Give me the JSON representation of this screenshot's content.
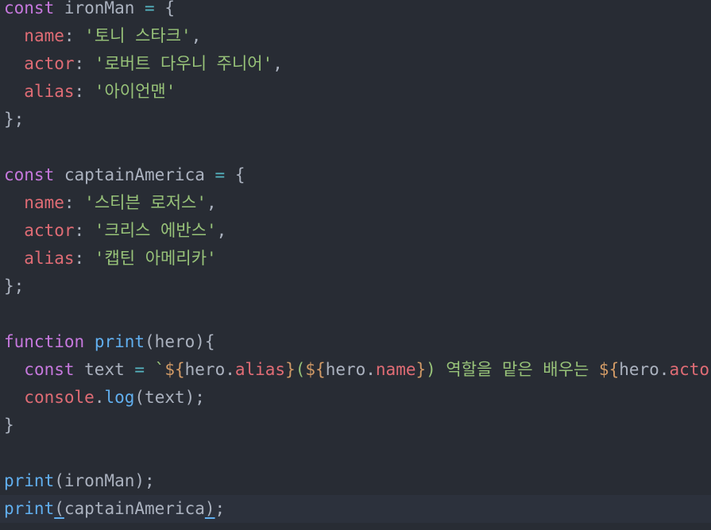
{
  "editor": {
    "theme_colors": {
      "background": "#282c34",
      "keyword": "#c678dd",
      "property": "#e06c75",
      "string": "#98c379",
      "function": "#61afef",
      "template_punctuation": "#d19a66",
      "text": "#abb2bf"
    },
    "lines": {
      "l1": {
        "kw": "const",
        "name": " ironMan ",
        "op": "=",
        "rest": " {"
      },
      "l2": {
        "indent": "  ",
        "key": "name",
        "colon": ": ",
        "str": "'토니 스타크'",
        "end": ","
      },
      "l3": {
        "indent": "  ",
        "key": "actor",
        "colon": ": ",
        "str": "'로버트 다우니 주니어'",
        "end": ","
      },
      "l4": {
        "indent": "  ",
        "key": "alias",
        "colon": ": ",
        "str": "'아이언맨'",
        "end": ""
      },
      "l5": {
        "text": "};"
      },
      "l7": {
        "kw": "const",
        "name": " captainAmerica ",
        "op": "=",
        "rest": " {"
      },
      "l8": {
        "indent": "  ",
        "key": "name",
        "colon": ": ",
        "str": "'스티븐 로저스'",
        "end": ","
      },
      "l9": {
        "indent": "  ",
        "key": "actor",
        "colon": ": ",
        "str": "'크리스 에반스'",
        "end": ","
      },
      "l10": {
        "indent": "  ",
        "key": "alias",
        "colon": ": ",
        "str": "'캡틴 아메리카'",
        "end": ""
      },
      "l11": {
        "text": "};"
      },
      "l13": {
        "kw": "function",
        "sp": " ",
        "fn": "print",
        "rest": "(hero){"
      },
      "l14": {
        "indent": "  ",
        "kw": "const",
        "name": " text ",
        "op": "=",
        "sp": " ",
        "tick": "`",
        "d1": "${",
        "v1": "hero.",
        "p1": "alias",
        "c1": "}",
        "s1": "(",
        "d2": "${",
        "v2": "hero.",
        "p2": "name",
        "c2": "}",
        "s2": ") 역할을 맡은 배우는 ",
        "d3": "${",
        "v3": "hero.",
        "p3": "actor"
      },
      "l15": {
        "indent": "  ",
        "obj": "console",
        "dot": ".",
        "fn": "log",
        "rest": "(text);"
      },
      "l16": {
        "text": "}"
      },
      "l18": {
        "fn": "print",
        "rest": "(ironMan);"
      },
      "l19": {
        "fn": "print",
        "open": "(",
        "arg": "captainAmerica",
        "close": ")",
        "end": ";"
      }
    }
  }
}
